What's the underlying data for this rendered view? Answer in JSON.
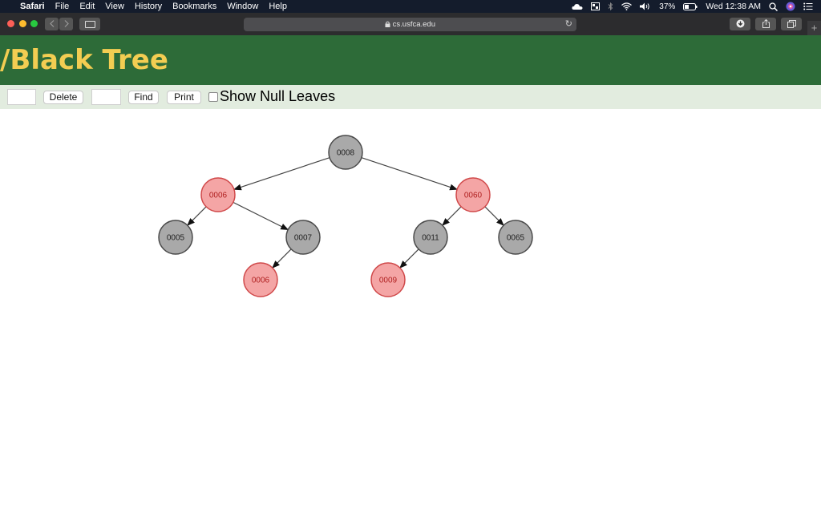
{
  "menubar": {
    "app": "Safari",
    "items": [
      "File",
      "Edit",
      "View",
      "History",
      "Bookmarks",
      "Window",
      "Help"
    ],
    "battery": "37%",
    "clock": "Wed 12:38 AM"
  },
  "browser": {
    "url": "cs.usfca.edu"
  },
  "page": {
    "title": "/Black Tree",
    "delete_label": "Delete",
    "find_label": "Find",
    "print_label": "Print",
    "null_leaves_label": "Show Null Leaves",
    "null_leaves_checked": false
  },
  "tree": {
    "nodes": [
      {
        "id": "n8",
        "label": "0008",
        "color": "black"
      },
      {
        "id": "n6",
        "label": "0006",
        "color": "red"
      },
      {
        "id": "n60",
        "label": "0060",
        "color": "red"
      },
      {
        "id": "n5",
        "label": "0005",
        "color": "black"
      },
      {
        "id": "n7",
        "label": "0007",
        "color": "black"
      },
      {
        "id": "n11",
        "label": "0011",
        "color": "black"
      },
      {
        "id": "n65",
        "label": "0065",
        "color": "black"
      },
      {
        "id": "n6b",
        "label": "0006",
        "color": "red"
      },
      {
        "id": "n9",
        "label": "0009",
        "color": "red"
      }
    ],
    "edges": [
      [
        "n8",
        "n6"
      ],
      [
        "n8",
        "n60"
      ],
      [
        "n6",
        "n5"
      ],
      [
        "n6",
        "n7"
      ],
      [
        "n7",
        "n6b"
      ],
      [
        "n60",
        "n11"
      ],
      [
        "n60",
        "n65"
      ],
      [
        "n11",
        "n9"
      ]
    ],
    "colors": {
      "black_fill": "#a9a9a9",
      "black_stroke": "#4a4a4a",
      "black_text": "#222222",
      "red_fill": "#f4a5a5",
      "red_stroke": "#d0494a",
      "red_text": "#b02020"
    }
  }
}
